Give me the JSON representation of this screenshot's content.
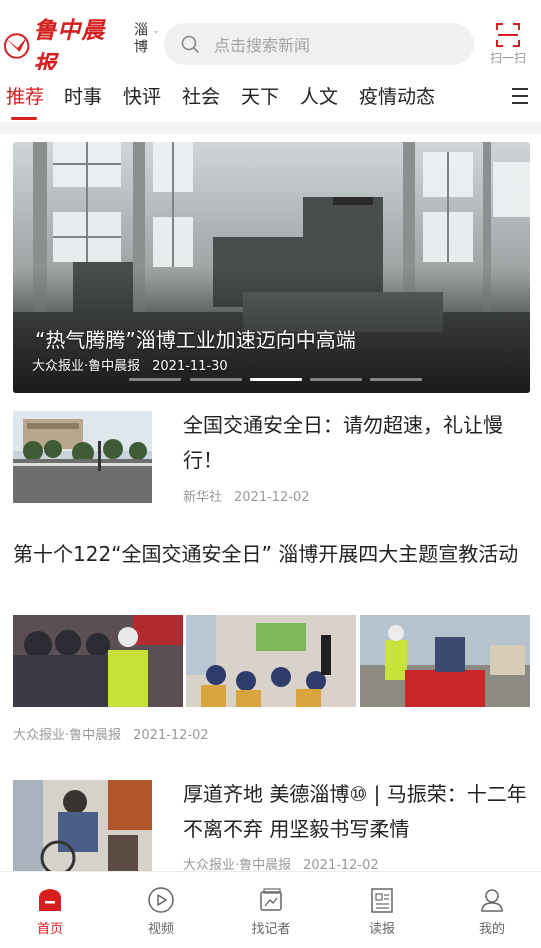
{
  "header": {
    "logo_text": "鲁中晨报",
    "city": "淄博",
    "search_placeholder": "点击搜索新闻",
    "scan_label": "扫一扫"
  },
  "tabs": [
    {
      "label": "推荐",
      "active": true
    },
    {
      "label": "时事",
      "active": false
    },
    {
      "label": "快评",
      "active": false
    },
    {
      "label": "社会",
      "active": false
    },
    {
      "label": "天下",
      "active": false
    },
    {
      "label": "人文",
      "active": false
    },
    {
      "label": "疫情动态",
      "active": false
    }
  ],
  "banner": {
    "title": "“热气腾腾”淄博工业加速迈向中高端",
    "source": "大众报业·鲁中晨报",
    "date": "2021-11-30",
    "slide_count": 5,
    "active_slide": 3
  },
  "news": [
    {
      "title": "全国交通安全日：请勿超速，礼让慢行！",
      "source": "新华社",
      "date": "2021-12-02"
    },
    {
      "title": "第十个122“全国交通安全日” 淄博开展四大主题宣教活动",
      "source": "大众报业·鲁中晨报",
      "date": "2021-12-02"
    },
    {
      "title": "厚道齐地 美德淄博⑩ | 马振荣：十二年不离不弃 用坚毅书写柔情",
      "source": "大众报业·鲁中晨报",
      "date": "2021-12-02"
    }
  ],
  "bottom_nav": [
    {
      "label": "首页",
      "icon": "home-icon",
      "active": true
    },
    {
      "label": "视频",
      "icon": "video-icon",
      "active": false
    },
    {
      "label": "找记者",
      "icon": "reporter-icon",
      "active": false
    },
    {
      "label": "读报",
      "icon": "newspaper-icon",
      "active": false
    },
    {
      "label": "我的",
      "icon": "profile-icon",
      "active": false
    }
  ],
  "colors": {
    "brand": "#d6201f",
    "muted_text": "#999999",
    "search_bg": "#f0f0f0"
  }
}
